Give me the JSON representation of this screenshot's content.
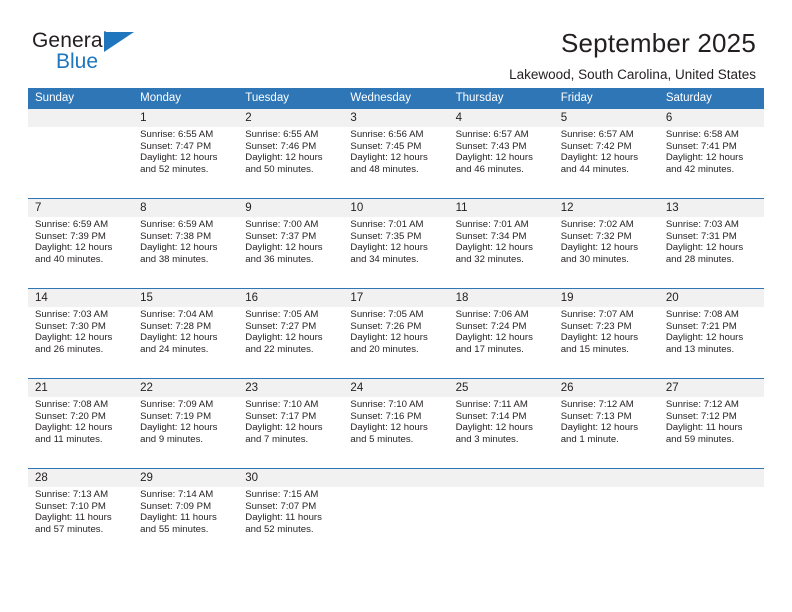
{
  "brand": {
    "name_top": "General",
    "name_bottom": "Blue",
    "triangle_icon": "blue-triangle-icon",
    "accent_color": "#1f76bc"
  },
  "header": {
    "title": "September 2025",
    "location": "Lakewood, South Carolina, United States",
    "header_bg_color": "#2f76b7",
    "datenum_bg_color": "#f1f1f1"
  },
  "weekday_headers": [
    "Sunday",
    "Monday",
    "Tuesday",
    "Wednesday",
    "Thursday",
    "Friday",
    "Saturday"
  ],
  "labels": {
    "sunrise_prefix": "Sunrise:",
    "sunset_prefix": "Sunset:",
    "daylight_prefix": "Daylight:"
  },
  "weeks": [
    {
      "days": [
        {
          "date": "",
          "sunrise": "",
          "sunset": "",
          "daylight": ""
        },
        {
          "date": "1",
          "sunrise": "Sunrise: 6:55 AM",
          "sunset": "Sunset: 7:47 PM",
          "daylight": "Daylight: 12 hours and 52 minutes."
        },
        {
          "date": "2",
          "sunrise": "Sunrise: 6:55 AM",
          "sunset": "Sunset: 7:46 PM",
          "daylight": "Daylight: 12 hours and 50 minutes."
        },
        {
          "date": "3",
          "sunrise": "Sunrise: 6:56 AM",
          "sunset": "Sunset: 7:45 PM",
          "daylight": "Daylight: 12 hours and 48 minutes."
        },
        {
          "date": "4",
          "sunrise": "Sunrise: 6:57 AM",
          "sunset": "Sunset: 7:43 PM",
          "daylight": "Daylight: 12 hours and 46 minutes."
        },
        {
          "date": "5",
          "sunrise": "Sunrise: 6:57 AM",
          "sunset": "Sunset: 7:42 PM",
          "daylight": "Daylight: 12 hours and 44 minutes."
        },
        {
          "date": "6",
          "sunrise": "Sunrise: 6:58 AM",
          "sunset": "Sunset: 7:41 PM",
          "daylight": "Daylight: 12 hours and 42 minutes."
        }
      ]
    },
    {
      "days": [
        {
          "date": "7",
          "sunrise": "Sunrise: 6:59 AM",
          "sunset": "Sunset: 7:39 PM",
          "daylight": "Daylight: 12 hours and 40 minutes."
        },
        {
          "date": "8",
          "sunrise": "Sunrise: 6:59 AM",
          "sunset": "Sunset: 7:38 PM",
          "daylight": "Daylight: 12 hours and 38 minutes."
        },
        {
          "date": "9",
          "sunrise": "Sunrise: 7:00 AM",
          "sunset": "Sunset: 7:37 PM",
          "daylight": "Daylight: 12 hours and 36 minutes."
        },
        {
          "date": "10",
          "sunrise": "Sunrise: 7:01 AM",
          "sunset": "Sunset: 7:35 PM",
          "daylight": "Daylight: 12 hours and 34 minutes."
        },
        {
          "date": "11",
          "sunrise": "Sunrise: 7:01 AM",
          "sunset": "Sunset: 7:34 PM",
          "daylight": "Daylight: 12 hours and 32 minutes."
        },
        {
          "date": "12",
          "sunrise": "Sunrise: 7:02 AM",
          "sunset": "Sunset: 7:32 PM",
          "daylight": "Daylight: 12 hours and 30 minutes."
        },
        {
          "date": "13",
          "sunrise": "Sunrise: 7:03 AM",
          "sunset": "Sunset: 7:31 PM",
          "daylight": "Daylight: 12 hours and 28 minutes."
        }
      ]
    },
    {
      "days": [
        {
          "date": "14",
          "sunrise": "Sunrise: 7:03 AM",
          "sunset": "Sunset: 7:30 PM",
          "daylight": "Daylight: 12 hours and 26 minutes."
        },
        {
          "date": "15",
          "sunrise": "Sunrise: 7:04 AM",
          "sunset": "Sunset: 7:28 PM",
          "daylight": "Daylight: 12 hours and 24 minutes."
        },
        {
          "date": "16",
          "sunrise": "Sunrise: 7:05 AM",
          "sunset": "Sunset: 7:27 PM",
          "daylight": "Daylight: 12 hours and 22 minutes."
        },
        {
          "date": "17",
          "sunrise": "Sunrise: 7:05 AM",
          "sunset": "Sunset: 7:26 PM",
          "daylight": "Daylight: 12 hours and 20 minutes."
        },
        {
          "date": "18",
          "sunrise": "Sunrise: 7:06 AM",
          "sunset": "Sunset: 7:24 PM",
          "daylight": "Daylight: 12 hours and 17 minutes."
        },
        {
          "date": "19",
          "sunrise": "Sunrise: 7:07 AM",
          "sunset": "Sunset: 7:23 PM",
          "daylight": "Daylight: 12 hours and 15 minutes."
        },
        {
          "date": "20",
          "sunrise": "Sunrise: 7:08 AM",
          "sunset": "Sunset: 7:21 PM",
          "daylight": "Daylight: 12 hours and 13 minutes."
        }
      ]
    },
    {
      "days": [
        {
          "date": "21",
          "sunrise": "Sunrise: 7:08 AM",
          "sunset": "Sunset: 7:20 PM",
          "daylight": "Daylight: 12 hours and 11 minutes."
        },
        {
          "date": "22",
          "sunrise": "Sunrise: 7:09 AM",
          "sunset": "Sunset: 7:19 PM",
          "daylight": "Daylight: 12 hours and 9 minutes."
        },
        {
          "date": "23",
          "sunrise": "Sunrise: 7:10 AM",
          "sunset": "Sunset: 7:17 PM",
          "daylight": "Daylight: 12 hours and 7 minutes."
        },
        {
          "date": "24",
          "sunrise": "Sunrise: 7:10 AM",
          "sunset": "Sunset: 7:16 PM",
          "daylight": "Daylight: 12 hours and 5 minutes."
        },
        {
          "date": "25",
          "sunrise": "Sunrise: 7:11 AM",
          "sunset": "Sunset: 7:14 PM",
          "daylight": "Daylight: 12 hours and 3 minutes."
        },
        {
          "date": "26",
          "sunrise": "Sunrise: 7:12 AM",
          "sunset": "Sunset: 7:13 PM",
          "daylight": "Daylight: 12 hours and 1 minute."
        },
        {
          "date": "27",
          "sunrise": "Sunrise: 7:12 AM",
          "sunset": "Sunset: 7:12 PM",
          "daylight": "Daylight: 11 hours and 59 minutes."
        }
      ]
    },
    {
      "days": [
        {
          "date": "28",
          "sunrise": "Sunrise: 7:13 AM",
          "sunset": "Sunset: 7:10 PM",
          "daylight": "Daylight: 11 hours and 57 minutes."
        },
        {
          "date": "29",
          "sunrise": "Sunrise: 7:14 AM",
          "sunset": "Sunset: 7:09 PM",
          "daylight": "Daylight: 11 hours and 55 minutes."
        },
        {
          "date": "30",
          "sunrise": "Sunrise: 7:15 AM",
          "sunset": "Sunset: 7:07 PM",
          "daylight": "Daylight: 11 hours and 52 minutes."
        },
        {
          "date": "",
          "sunrise": "",
          "sunset": "",
          "daylight": ""
        },
        {
          "date": "",
          "sunrise": "",
          "sunset": "",
          "daylight": ""
        },
        {
          "date": "",
          "sunrise": "",
          "sunset": "",
          "daylight": ""
        },
        {
          "date": "",
          "sunrise": "",
          "sunset": "",
          "daylight": ""
        }
      ]
    }
  ]
}
